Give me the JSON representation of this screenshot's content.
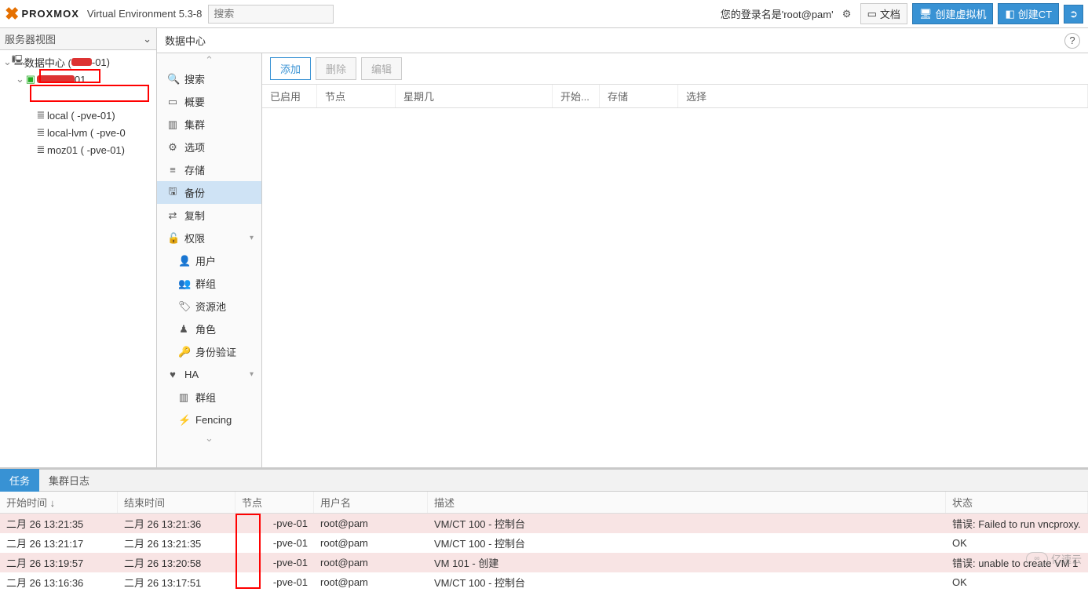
{
  "header": {
    "logo_text": "PROXMOX",
    "env_label": "Virtual Environment 5.3-8",
    "search_placeholder": "搜索",
    "login_text": "您的登录名是'root@pam'",
    "doc_label": "文档",
    "create_vm_label": "创建虚拟机",
    "create_ct_label": "创建CT"
  },
  "tree": {
    "view_label": "服务器视图",
    "dc_label": "数据中心 (",
    "dc_suffix": "-01)",
    "node_suffix": "01",
    "storage": [
      "local (        -pve-01)",
      "local-lvm (        -pve-0",
      "moz01 (        -pve-01)"
    ]
  },
  "crumb": {
    "title": "数据中心"
  },
  "sidenav": {
    "items": [
      {
        "icon": "🔍",
        "label": "搜索"
      },
      {
        "icon": "▭",
        "label": "概要"
      },
      {
        "icon": "▥",
        "label": "集群"
      },
      {
        "icon": "⚙",
        "label": "选项"
      },
      {
        "icon": "≡",
        "label": "存储"
      },
      {
        "icon": "🖫",
        "label": "备份",
        "active": true
      },
      {
        "icon": "⇄",
        "label": "复制"
      },
      {
        "icon": "🔓",
        "label": "权限",
        "expand": true
      },
      {
        "icon": "👤",
        "label": "用户",
        "sub": true
      },
      {
        "icon": "👥",
        "label": "群组",
        "sub": true
      },
      {
        "icon": "🏷",
        "label": "资源池",
        "sub": true
      },
      {
        "icon": "♟",
        "label": "角色",
        "sub": true
      },
      {
        "icon": "🔑",
        "label": "身份验证",
        "sub": true
      },
      {
        "icon": "♥",
        "label": "HA",
        "expand": true
      },
      {
        "icon": "▥",
        "label": "群组",
        "sub": true
      },
      {
        "icon": "⚡",
        "label": "Fencing",
        "sub": true
      }
    ]
  },
  "toolbar": {
    "add": "添加",
    "del": "删除",
    "edit": "编辑"
  },
  "grid_cols": {
    "enabled": "已启用",
    "node": "节点",
    "weekday": "星期几",
    "start": "开始...",
    "storage": "存储",
    "select": "选择"
  },
  "log_tabs": {
    "tasks": "任务",
    "cluster": "集群日志"
  },
  "log_cols": {
    "start": "开始时间 ↓",
    "end": "结束时间",
    "node": "节点",
    "user": "用户名",
    "desc": "描述",
    "status": "状态"
  },
  "log_rows": [
    {
      "start": "二月 26 13:21:35",
      "end": "二月 26 13:21:36",
      "node": "-pve-01",
      "user": "root@pam",
      "desc": "VM/CT 100 - 控制台",
      "status": "错误: Failed to run vncproxy.",
      "err": true
    },
    {
      "start": "二月 26 13:21:17",
      "end": "二月 26 13:21:35",
      "node": "-pve-01",
      "user": "root@pam",
      "desc": "VM/CT 100 - 控制台",
      "status": "OK",
      "err": false
    },
    {
      "start": "二月 26 13:19:57",
      "end": "二月 26 13:20:58",
      "node": "-pve-01",
      "user": "root@pam",
      "desc": "VM 101 - 创建",
      "status": "错误: unable to create VM 1",
      "err": true
    },
    {
      "start": "二月 26 13:16:36",
      "end": "二月 26 13:17:51",
      "node": "-pve-01",
      "user": "root@pam",
      "desc": "VM/CT 100 - 控制台",
      "status": "OK",
      "err": false
    }
  ],
  "watermark": "亿速云"
}
